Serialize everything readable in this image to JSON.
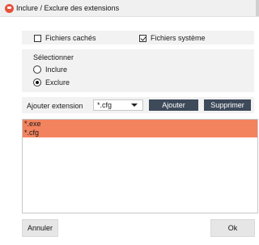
{
  "window": {
    "title": "Inclure / Exclure des extensions",
    "app_icon": "app-logo-icon"
  },
  "options": {
    "hidden_files_label": "Fichiers cachés",
    "hidden_files_checked": false,
    "system_files_label": "Fichiers système",
    "system_files_checked": true
  },
  "selection": {
    "heading": "Sélectionner",
    "include_label": "Inclure",
    "exclude_label": "Exclure",
    "selected": "exclude"
  },
  "extension": {
    "label": "Ajouter extension",
    "value": "*.cfg",
    "add_label": "Ajouter",
    "delete_label": "Supprimer"
  },
  "list": {
    "items": [
      "*.exe",
      "*.cfg"
    ],
    "highlight_color": "#f3835f"
  },
  "footer": {
    "cancel_label": "Annuler",
    "ok_label": "Ok"
  },
  "colors": {
    "accent_button": "#3e4a5a",
    "panel_bg": "#f2f2f2"
  }
}
